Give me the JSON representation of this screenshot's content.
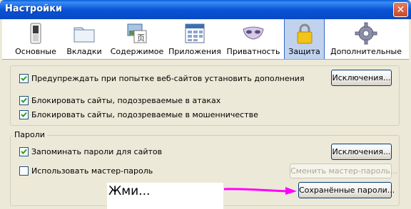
{
  "window": {
    "title": "Настройки",
    "close_symbol": "✕"
  },
  "tabs": [
    {
      "label": "Основные",
      "icon": "switch-icon"
    },
    {
      "label": "Вкладки",
      "icon": "folder-tabs-icon"
    },
    {
      "label": "Содержимое",
      "icon": "content-icon"
    },
    {
      "label": "Приложения",
      "icon": "applications-icon"
    },
    {
      "label": "Приватность",
      "icon": "mask-icon"
    },
    {
      "label": "Защита",
      "icon": "lock-icon",
      "selected": true
    },
    {
      "label": "Дополнительные",
      "icon": "gear-icon"
    }
  ],
  "security": {
    "warn_addons": {
      "label": "Предупреждать при попытке веб-сайтов установить дополнения",
      "checked": true
    },
    "exceptions_label": "Исключения...",
    "block_attack": {
      "label": "Блокировать сайты, подозреваемые в атаках",
      "checked": true
    },
    "block_forgery": {
      "label": "Блокировать сайты, подозреваемые в мошенничестве",
      "checked": true
    }
  },
  "passwords": {
    "legend": "Пароли",
    "remember": {
      "label": "Запоминать пароли для сайтов",
      "checked": true
    },
    "exceptions_label": "Исключения...",
    "master": {
      "label": "Использовать мастер-пароль",
      "checked": false
    },
    "change_master_label": "Сменить мастер-пароль...",
    "saved_label": "Сохранённые пароли..."
  },
  "annotation": {
    "text": "Жми...",
    "arrow_color": "#ff00ff"
  }
}
